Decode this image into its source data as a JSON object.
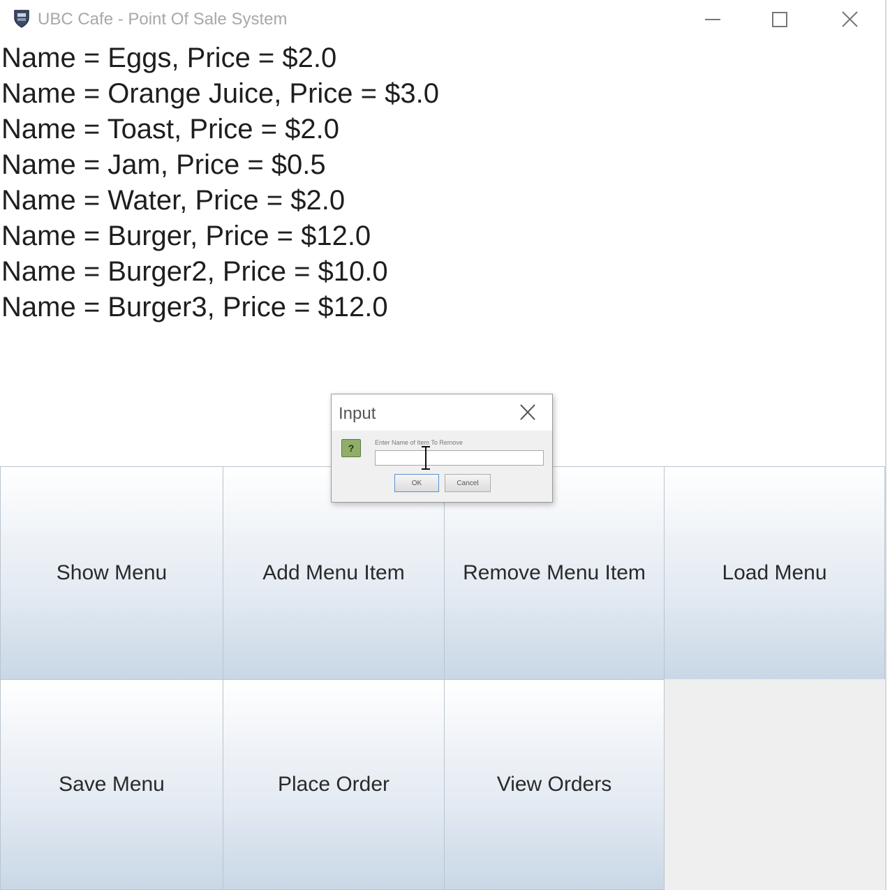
{
  "window": {
    "title": "UBC Cafe - Point Of Sale System",
    "icon": "app-crest-icon",
    "controls": [
      "minimize-icon",
      "maximize-icon",
      "close-icon"
    ]
  },
  "menu_lines": [
    "Name = Eggs, Price = $2.0",
    "Name = Orange Juice, Price = $3.0",
    "Name = Toast, Price = $2.0",
    "Name = Jam, Price = $0.5",
    "Name = Water, Price = $2.0",
    "Name = Burger, Price = $12.0",
    "Name = Burger2, Price = $10.0",
    "Name = Burger3, Price = $12.0"
  ],
  "buttons": {
    "show_menu": "Show Menu",
    "add_menu_item": "Add Menu Item",
    "remove_menu_item": "Remove Menu Item",
    "load_menu": "Load Menu",
    "save_menu": "Save Menu",
    "place_order": "Place Order",
    "view_orders": "View Orders"
  },
  "dialog": {
    "title": "Input",
    "prompt": "Enter Name of Item To Remove",
    "input_value": "",
    "ok_label": "OK",
    "cancel_label": "Cancel",
    "icon": "question-icon"
  },
  "colors": {
    "button_gradient_top": "#ffffff",
    "button_gradient_bottom": "#c9d7e6",
    "question_icon": "#8fae6a"
  }
}
